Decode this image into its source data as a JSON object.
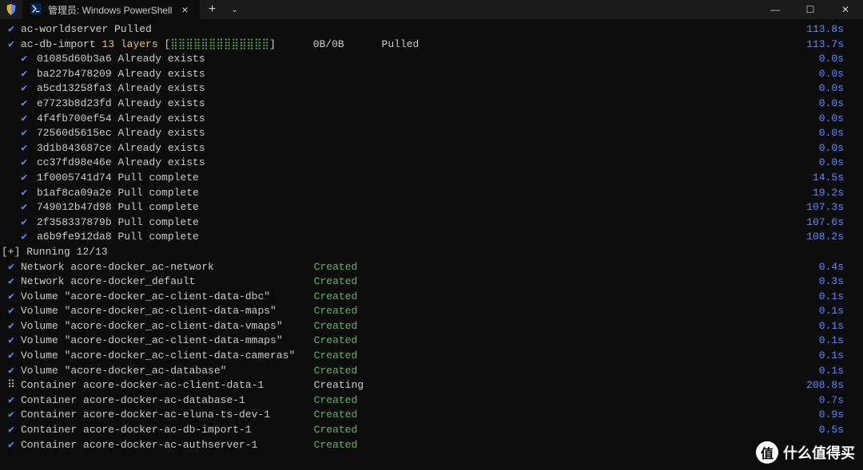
{
  "window": {
    "tab_title": "管理员: Windows PowerShell",
    "close_x": "×",
    "new_tab": "+",
    "dropdown": "⌄",
    "minimize": "—",
    "maximize": "☐",
    "win_close": "✕"
  },
  "pull_top": [
    {
      "name": "ac-worldserver",
      "status": "Pulled",
      "time": "113.8s"
    }
  ],
  "import_line": {
    "name": "ac-db-import",
    "layers_label": "13 layers",
    "bar_open": "[",
    "bar_fill": "⣿⣿⣿⣿⣿⣿⣿⣿⣿⣿⣿⣿⣿",
    "bar_close": "]",
    "bytes": "0B/0B",
    "status": "Pulled",
    "time": "113.7s"
  },
  "layers": [
    {
      "id": "01085d60b3a6",
      "status": "Already exists",
      "time": "0.0s"
    },
    {
      "id": "ba227b478209",
      "status": "Already exists",
      "time": "0.0s"
    },
    {
      "id": "a5cd13258fa3",
      "status": "Already exists",
      "time": "0.0s"
    },
    {
      "id": "e7723b8d23fd",
      "status": "Already exists",
      "time": "0.0s"
    },
    {
      "id": "4f4fb700ef54",
      "status": "Already exists",
      "time": "0.0s"
    },
    {
      "id": "72560d5615ec",
      "status": "Already exists",
      "time": "0.0s"
    },
    {
      "id": "3d1b843687ce",
      "status": "Already exists",
      "time": "0.0s"
    },
    {
      "id": "cc37fd98e46e",
      "status": "Already exists",
      "time": "0.0s"
    },
    {
      "id": "1f0005741d74",
      "status": "Pull complete",
      "time": "14.5s"
    },
    {
      "id": "b1af8ca09a2e",
      "status": "Pull complete",
      "time": "19.2s"
    },
    {
      "id": "749012b47d98",
      "status": "Pull complete",
      "time": "107.3s"
    },
    {
      "id": "2f358337879b",
      "status": "Pull complete",
      "time": "107.6s"
    },
    {
      "id": "a6b9fe912da8",
      "status": "Pull complete",
      "time": "108.2s"
    }
  ],
  "running_header": "[+] Running 12/13",
  "resources": [
    {
      "kind": "check",
      "label": "Network acore-docker_ac-network",
      "status": "Created",
      "time": "0.4s"
    },
    {
      "kind": "check",
      "label": "Network acore-docker_default",
      "status": "Created",
      "time": "0.3s"
    },
    {
      "kind": "check",
      "label": "Volume \"acore-docker_ac-client-data-dbc\"",
      "status": "Created",
      "time": "0.1s"
    },
    {
      "kind": "check",
      "label": "Volume \"acore-docker_ac-client-data-maps\"",
      "status": "Created",
      "time": "0.1s"
    },
    {
      "kind": "check",
      "label": "Volume \"acore-docker_ac-client-data-vmaps\"",
      "status": "Created",
      "time": "0.1s"
    },
    {
      "kind": "check",
      "label": "Volume \"acore-docker_ac-client-data-mmaps\"",
      "status": "Created",
      "time": "0.1s"
    },
    {
      "kind": "check",
      "label": "Volume \"acore-docker_ac-client-data-cameras\"",
      "status": "Created",
      "time": "0.1s"
    },
    {
      "kind": "check",
      "label": "Volume \"acore-docker_ac-database\"",
      "status": "Created",
      "time": "0.1s"
    },
    {
      "kind": "spinner",
      "label": "Container acore-docker-ac-client-data-1",
      "status": "Creating",
      "time": "208.8s"
    },
    {
      "kind": "check",
      "label": "Container acore-docker-ac-database-1",
      "status": "Created",
      "time": "0.7s"
    },
    {
      "kind": "check",
      "label": "Container acore-docker-ac-eluna-ts-dev-1",
      "status": "Created",
      "time": "0.9s"
    },
    {
      "kind": "check",
      "label": "Container acore-docker-ac-db-import-1",
      "status": "Created",
      "time": "0.5s"
    },
    {
      "kind": "check",
      "label": "Container acore-docker-ac-authserver-1",
      "status": "Created",
      "time": ""
    }
  ],
  "watermark": "什么值得买"
}
